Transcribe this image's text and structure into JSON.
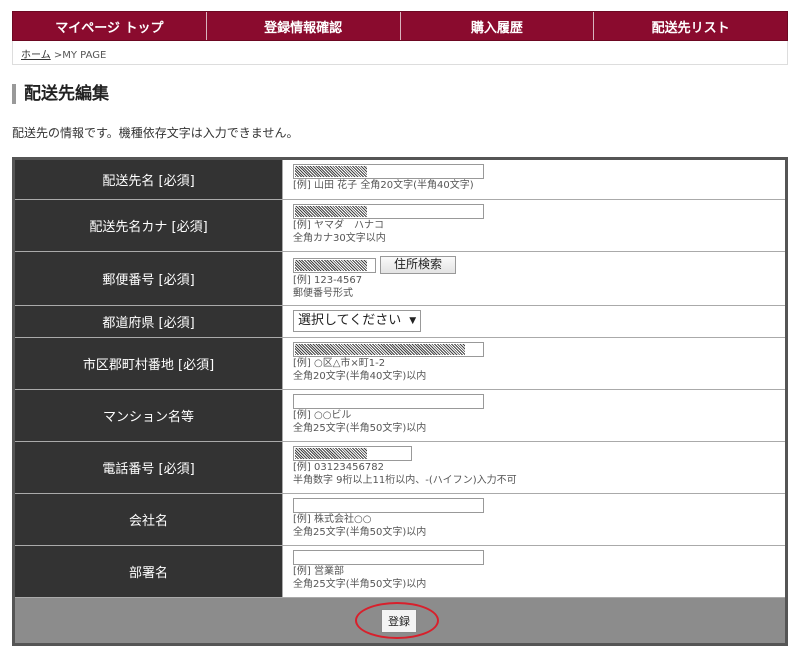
{
  "nav": {
    "items": [
      {
        "label": "マイページ トップ"
      },
      {
        "label": "登録情報確認"
      },
      {
        "label": "購入履歴"
      },
      {
        "label": "配送先リスト"
      }
    ]
  },
  "breadcrumb": {
    "home": "ホーム",
    "separator": " >MY PAGE"
  },
  "page": {
    "title": "配送先編集",
    "intro": "配送先の情報です。機種依存文字は入力できません。"
  },
  "form": {
    "name": {
      "label": "配送先名 [必須]",
      "example": "[例] 山田 花子 全角20文字(半角40文字)"
    },
    "kana": {
      "label": "配送先名カナ [必須]",
      "example": "[例] ヤマダ　ハナコ",
      "note": "全角カナ30文字以内"
    },
    "zip": {
      "label": "郵便番号 [必須]",
      "button": "住所検索",
      "example": "[例] 123-4567",
      "note": "郵便番号形式"
    },
    "prefecture": {
      "label": "都道府県 [必須]",
      "selected": "選択してください"
    },
    "city": {
      "label": "市区郡町村番地 [必須]",
      "example": "[例] ○区△市×町1-2",
      "note": "全角20文字(半角40文字)以内"
    },
    "building": {
      "label": "マンション名等",
      "example": "[例] ○○ビル",
      "note": "全角25文字(半角50文字)以内"
    },
    "phone": {
      "label": "電話番号 [必須]",
      "example": "[例] 03123456782",
      "note": "半角数字 9桁以上11桁以内、-(ハイフン)入力不可"
    },
    "company": {
      "label": "会社名",
      "example": "[例] 株式会社○○",
      "note": "全角25文字(半角50文字)以内"
    },
    "department": {
      "label": "部署名",
      "example": "[例] 営業部",
      "note": "全角25文字(半角50文字)以内"
    },
    "submit": "登録"
  },
  "colors": {
    "nav_bg": "#8a0b2e",
    "label_bg": "#333333",
    "footer_bg": "#8c8c8c",
    "highlight": "#d8202c"
  }
}
